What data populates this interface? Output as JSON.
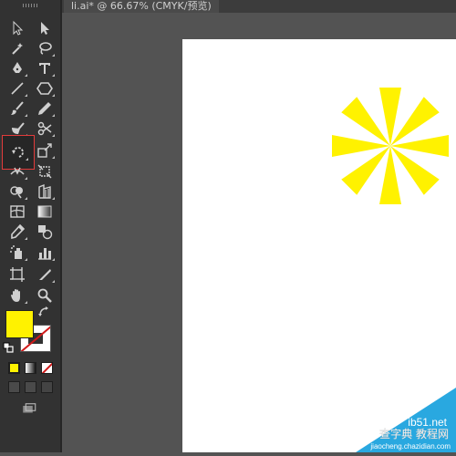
{
  "document_tab": {
    "title": "li.ai* @ 66.67% (CMYK/预览)"
  },
  "toolbar": {
    "tools": [
      {
        "name": "selection-tool"
      },
      {
        "name": "direct-selection-tool"
      },
      {
        "name": "magic-wand-tool"
      },
      {
        "name": "lasso-tool"
      },
      {
        "name": "pen-tool"
      },
      {
        "name": "type-tool"
      },
      {
        "name": "line-segment-tool"
      },
      {
        "name": "polygon-tool"
      },
      {
        "name": "paintbrush-tool"
      },
      {
        "name": "pencil-tool"
      },
      {
        "name": "blob-brush-tool"
      },
      {
        "name": "scissors-tool"
      },
      {
        "name": "rotate-tool"
      },
      {
        "name": "scale-tool"
      },
      {
        "name": "width-tool"
      },
      {
        "name": "free-transform-tool"
      },
      {
        "name": "shape-builder-tool"
      },
      {
        "name": "perspective-grid-tool"
      },
      {
        "name": "mesh-tool"
      },
      {
        "name": "gradient-tool"
      },
      {
        "name": "eyedropper-tool"
      },
      {
        "name": "blend-tool"
      },
      {
        "name": "symbol-sprayer-tool"
      },
      {
        "name": "column-graph-tool"
      },
      {
        "name": "artboard-tool"
      },
      {
        "name": "slice-tool"
      },
      {
        "name": "hand-tool"
      },
      {
        "name": "zoom-tool"
      }
    ],
    "active_tool": "rotate-tool"
  },
  "colors": {
    "fill": "#fff200",
    "stroke": "none",
    "artwork": "#fff200",
    "highlight_border": "#e23b3b"
  },
  "artwork": {
    "shape": "pinwheel-star",
    "blades": 8
  },
  "watermark": {
    "line1": "ib51.net",
    "line2": "查字典 教程网",
    "line3": "jiaocheng.chazidian.com"
  }
}
